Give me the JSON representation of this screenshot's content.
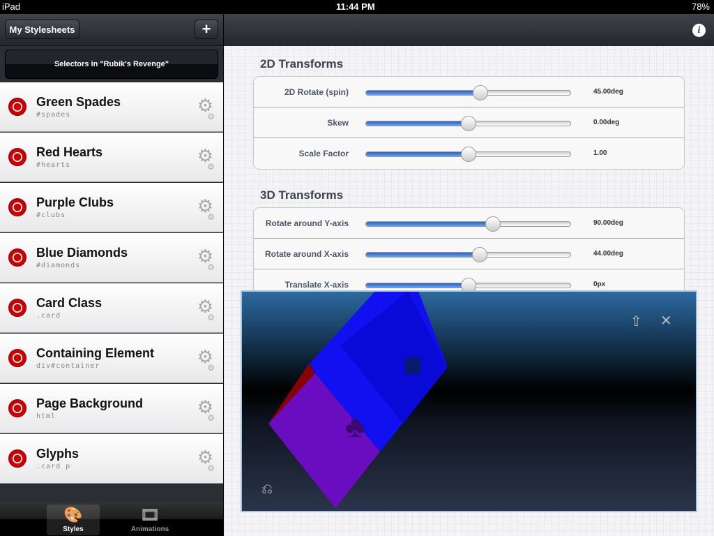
{
  "status": {
    "device": "iPad",
    "time": "11:44 PM",
    "battery": "78%"
  },
  "sidebar": {
    "back_label": "My Stylesheets",
    "add_label": "+",
    "header": "Selectors in \"Rubik's Revenge\"",
    "items": [
      {
        "title": "Green Spades",
        "selector": "#spades"
      },
      {
        "title": "Red Hearts",
        "selector": "#hearts"
      },
      {
        "title": "Purple Clubs",
        "selector": "#clubs"
      },
      {
        "title": "Blue Diamonds",
        "selector": "#diamonds"
      },
      {
        "title": "Card Class",
        "selector": ".card"
      },
      {
        "title": "Containing Element",
        "selector": "div#container"
      },
      {
        "title": "Page Background",
        "selector": "html"
      },
      {
        "title": "Glyphs",
        "selector": ".card p"
      }
    ],
    "tabs": [
      {
        "label": "Styles",
        "icon": "palette-icon",
        "active": true
      },
      {
        "label": "Animations",
        "icon": "film-icon",
        "active": false
      }
    ]
  },
  "main": {
    "info_icon": "i",
    "sections": [
      {
        "title": "2D Transforms",
        "rows": [
          {
            "label": "2D Rotate (spin)",
            "value": "45.00deg",
            "fraction": 0.56
          },
          {
            "label": "Skew",
            "value": "0.00deg",
            "fraction": 0.5
          },
          {
            "label": "Scale Factor",
            "value": "1.00",
            "fraction": 0.5
          }
        ]
      },
      {
        "title": "3D Transforms",
        "rows": [
          {
            "label": "Rotate around Y-axis",
            "value": "90.00deg",
            "fraction": 0.62
          },
          {
            "label": "Rotate around X-axis",
            "value": "44.00deg",
            "fraction": 0.555
          },
          {
            "label": "Translate X-axis",
            "value": "0px",
            "fraction": 0.5
          }
        ]
      }
    ]
  },
  "preview": {
    "club": "♣",
    "colors": {
      "purple": "#6a0cc0",
      "blue": "#1010f0",
      "dark_blue": "#0a0ad8",
      "red": "#8a0000"
    }
  },
  "colors": {
    "slider_fill": "#2a63c0"
  }
}
